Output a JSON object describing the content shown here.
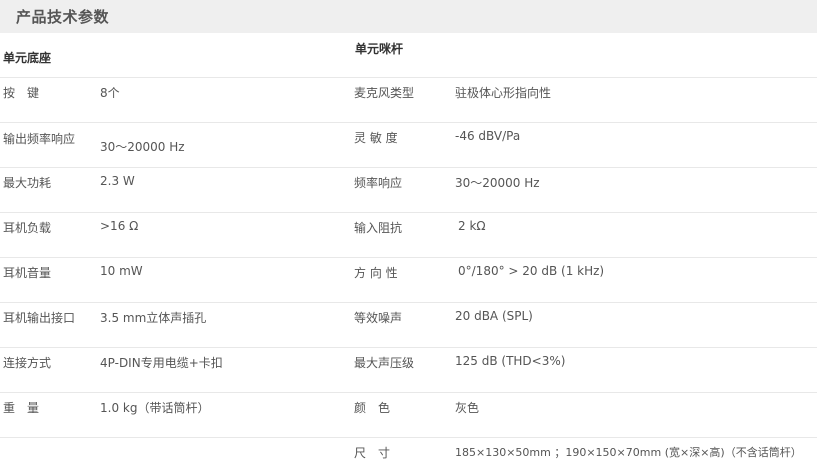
{
  "header": {
    "title": "产品技术参数"
  },
  "sections": {
    "left_title": "单元底座",
    "right_title": "单元咪杆"
  },
  "specs": {
    "left": [
      {
        "label": "按　键",
        "value": "8个"
      },
      {
        "label": "输出频率响应",
        "value": "30～20000 Hz"
      },
      {
        "label": "最大功耗",
        "value": "2.3 W"
      },
      {
        "label": "耳机负载",
        "value": ">16 Ω"
      },
      {
        "label": "耳机音量",
        "value": "10 mW"
      },
      {
        "label": "耳机输出接口",
        "value": "3.5 mm立体声插孔"
      },
      {
        "label": "连接方式",
        "value": "4P-DIN专用电缆+卡扣"
      },
      {
        "label": "重　量",
        "value": "1.0 kg（带话筒杆）"
      }
    ],
    "right": [
      {
        "label": "麦克风类型",
        "value": "驻极体心形指向性"
      },
      {
        "label": "灵 敏 度",
        "value": "-46 dBV/Pa"
      },
      {
        "label": "频率响应",
        "value": "30～20000 Hz"
      },
      {
        "label": "输入阻抗",
        "value": "2 kΩ"
      },
      {
        "label": "方 向 性",
        "value": "0°/180° > 20 dB (1 kHz)"
      },
      {
        "label": "等效噪声",
        "value": "20 dBA (SPL)"
      },
      {
        "label": "最大声压级",
        "value": "125 dB (THD<3%)"
      },
      {
        "label": "颜　色",
        "value": "灰色"
      },
      {
        "label": "尺　寸",
        "value": "185×130×50mm ；190×150×70mm (宽×深×高)（不含话筒杆）"
      }
    ]
  }
}
